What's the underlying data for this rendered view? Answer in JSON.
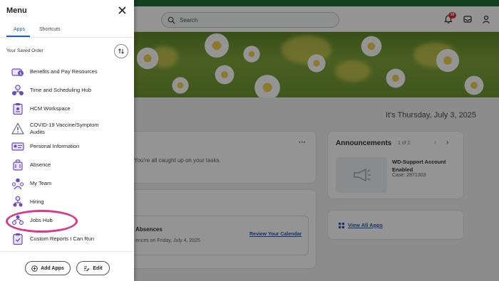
{
  "header": {
    "search_placeholder": "Search",
    "notification_count": "39"
  },
  "main": {
    "date": "It's Thursday, July 3, 2025",
    "tasks_card": {
      "more": "···",
      "caught_up": "You're all caught up on your tasks."
    },
    "timeoff_card": {
      "title": "Absences",
      "subtitle": "ences on Friday, July 4, 2025",
      "link": "Review Your Calendar"
    },
    "announcements": {
      "title": "Announcements",
      "pager": "1 of 2",
      "prev": "‹",
      "next": "›",
      "headline": "WD-Support Account Enabled",
      "case": "Case: 2871303"
    },
    "view_all_apps": "View All Apps"
  },
  "drawer": {
    "title": "Menu",
    "tabs": [
      {
        "label": "Apps",
        "active": true
      },
      {
        "label": "Shortcuts",
        "active": false
      }
    ],
    "order_label": "Your Saved Order",
    "apps": [
      {
        "label": "Benefits and Pay Resources",
        "icon": "benefits-icon"
      },
      {
        "label": "Time and Scheduling Hub",
        "icon": "time-hub-icon"
      },
      {
        "label": "HCM Workspace",
        "icon": "clipboard-icon"
      },
      {
        "label": "COVID-19 Vaccine/Symptom Audits",
        "icon": "warning-icon"
      },
      {
        "label": "Personal Information",
        "icon": "id-card-icon"
      },
      {
        "label": "Absence",
        "icon": "suitcase-icon"
      },
      {
        "label": "My Team",
        "icon": "team-icon"
      },
      {
        "label": "Hiring",
        "icon": "hiring-icon"
      },
      {
        "label": "Jobs Hub",
        "icon": "jobs-hub-icon"
      },
      {
        "label": "Custom Reports I Can Run",
        "icon": "report-icon"
      }
    ],
    "add_apps_label": "Add Apps",
    "edit_label": "Edit"
  },
  "colors": {
    "accent": "#1b5fb8",
    "highlight": "#d8398f",
    "icon_purple": "#6a4bc4",
    "top_strip": "#1f6f3a"
  }
}
